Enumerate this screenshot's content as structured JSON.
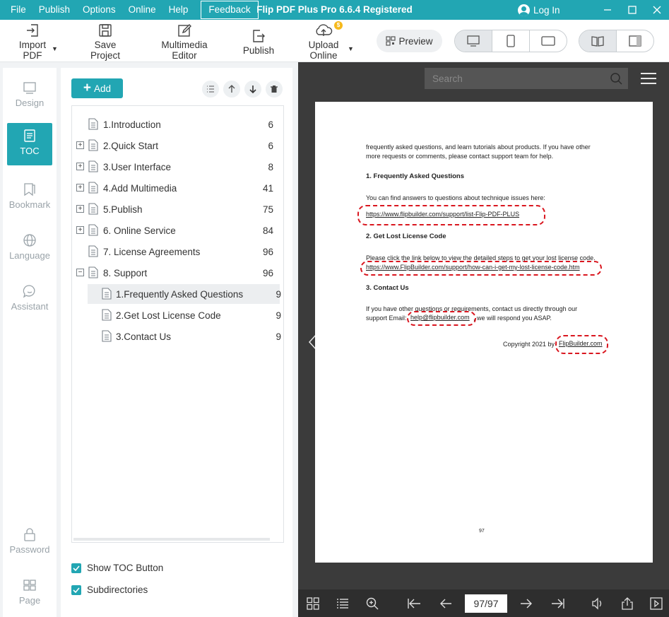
{
  "titlebar": {
    "menu": [
      "File",
      "Publish",
      "Options",
      "Online",
      "Help"
    ],
    "feedback_label": "Feedback",
    "app_title": "Flip PDF Plus Pro 6.6.4 Registered",
    "login_label": "Log In"
  },
  "toolbar": {
    "import_label_1": "Import",
    "import_label_2": "PDF",
    "save_label_1": "Save",
    "save_label_2": "Project",
    "multimedia_label_1": "Multimedia",
    "multimedia_label_2": "Editor",
    "publish_label": "Publish",
    "upload_label_1": "Upload",
    "upload_label_2": "Online",
    "upload_badge": "$",
    "preview_label": "Preview"
  },
  "leftnav": {
    "items": [
      {
        "label": "Design"
      },
      {
        "label": "TOC"
      },
      {
        "label": "Bookmark"
      },
      {
        "label": "Language"
      },
      {
        "label": "Assistant"
      },
      {
        "label": "Password"
      },
      {
        "label": "Page"
      }
    ]
  },
  "toc": {
    "add_label": "Add",
    "rows": [
      {
        "label": "1.Introduction",
        "page": "6"
      },
      {
        "label": "2.Quick Start",
        "page": "6"
      },
      {
        "label": "3.User Interface",
        "page": "8"
      },
      {
        "label": "4.Add Multimedia",
        "page": "41"
      },
      {
        "label": "5.Publish",
        "page": "75"
      },
      {
        "label": "6. Online Service",
        "page": "84"
      },
      {
        "label": "7. License Agreements",
        "page": "96"
      },
      {
        "label": "8. Support",
        "page": "96"
      },
      {
        "label": "1.Frequently Asked Questions",
        "page": "9"
      },
      {
        "label": "2.Get Lost License Code",
        "page": "9"
      },
      {
        "label": "3.Contact Us",
        "page": "9"
      }
    ],
    "show_toc_button_label": "Show TOC Button",
    "subdirectories_label": "Subdirectories"
  },
  "preview": {
    "search_placeholder": "Search",
    "page_indicator": "97/97",
    "page": {
      "intro_1": "frequently asked questions, and learn tutorials about products. If you have other",
      "intro_2": "more requests or comments, please contact support team for help.",
      "h1": "1.  Frequently Asked Questions",
      "p1": "You can find answers to questions about technique issues here:",
      "link1": "https://www.flipbuilder.com/support/list-Flip-PDF-PLUS",
      "h2": "2.  Get Lost License Code",
      "p2": "Please click the link below to view the detailed steps to get your lost license code.",
      "link2": "https://www.FlipBuilder.com/support/how-can-i-get-my-lost-license-code.htm",
      "h3": "3.  Contact Us",
      "p3_1": "If you have other questions or requirements, contact us directly through our",
      "p3_2a": "support Email:",
      "email": "help@flipbuilder.com",
      "p3_2b": ", we will respond you ASAP.",
      "copyright": "Copyright 2021 by",
      "site": "FlipBuilder.com",
      "page_number": "97"
    }
  },
  "colors": {
    "accent": "#22a6b3",
    "highlight": "#d9161f",
    "preview_bg": "#3b3b3b"
  }
}
